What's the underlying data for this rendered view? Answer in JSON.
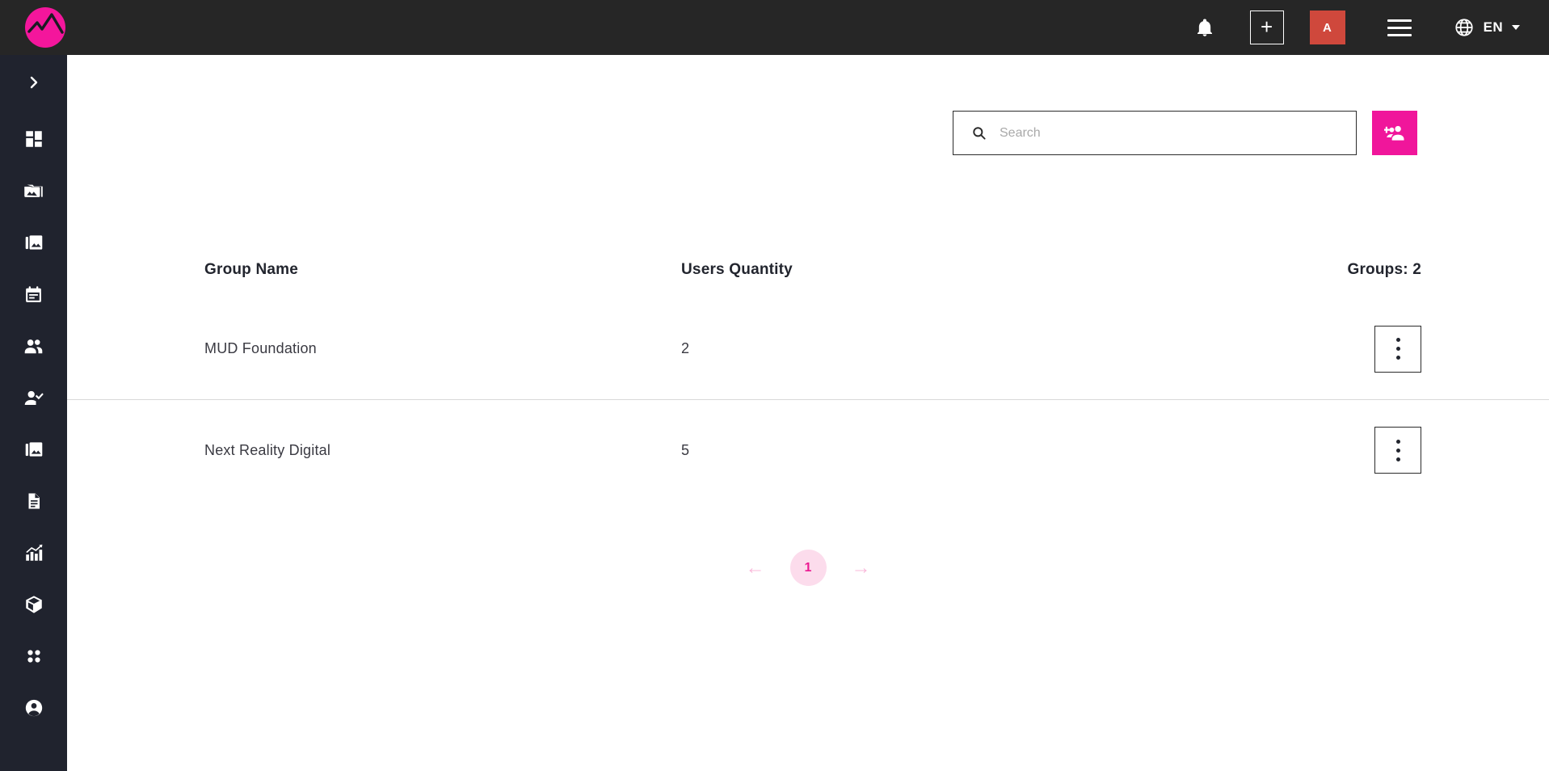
{
  "topbar": {
    "logo_name": "brand-logo",
    "notifications_icon": "bell-icon",
    "add_label": "+",
    "avatar_initial": "A",
    "avatar_color": "#cf483c",
    "menu_icon": "hamburger-icon",
    "language": "EN",
    "accent_color": "#f0169b",
    "background": "#262626"
  },
  "sidebar": {
    "background": "#20232e",
    "toggle_icon": "chevron-right-icon",
    "items": [
      {
        "icon": "dashboard-grid-icon",
        "name": "sidebar-item-dashboard"
      },
      {
        "icon": "photo-library-icon",
        "name": "sidebar-item-media-library"
      },
      {
        "icon": "image-collection-icon",
        "name": "sidebar-item-images"
      },
      {
        "icon": "calendar-icon",
        "name": "sidebar-item-calendar"
      },
      {
        "icon": "people-icon",
        "name": "sidebar-item-users"
      },
      {
        "icon": "person-check-icon",
        "name": "sidebar-item-approvals"
      },
      {
        "icon": "image-collection-icon",
        "name": "sidebar-item-gallery"
      },
      {
        "icon": "document-icon",
        "name": "sidebar-item-documents"
      },
      {
        "icon": "bar-chart-icon",
        "name": "sidebar-item-analytics"
      },
      {
        "icon": "cube-icon",
        "name": "sidebar-item-packages"
      },
      {
        "icon": "apps-grid-icon",
        "name": "sidebar-item-apps"
      },
      {
        "icon": "account-circle-icon",
        "name": "sidebar-item-account"
      }
    ]
  },
  "toolbar": {
    "search_placeholder": "Search",
    "search_value": "",
    "search_icon": "search-icon",
    "add_group_icon": "group-add-icon"
  },
  "table": {
    "columns": [
      "Group Name",
      "Users Quantity"
    ],
    "summary": "Groups: 2",
    "rows": [
      {
        "group_name": "MUD Foundation",
        "users_quantity": "2"
      },
      {
        "group_name": "Next Reality Digital",
        "users_quantity": "5"
      }
    ],
    "row_action_icon": "more-vertical-icon"
  },
  "pagination": {
    "prev": "←",
    "next": "→",
    "current_page": "1"
  }
}
